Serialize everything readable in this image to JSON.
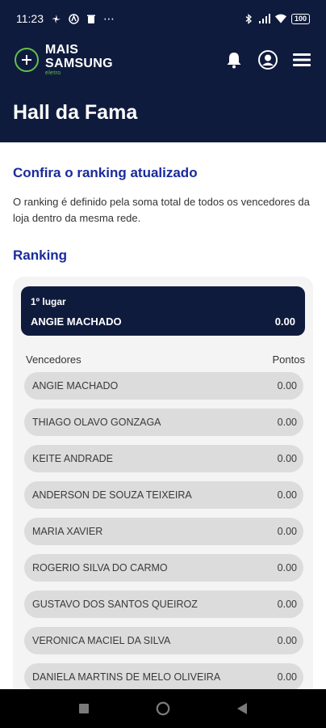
{
  "status": {
    "time": "11:23",
    "battery": "100"
  },
  "app": {
    "brand_line1": "MAIS",
    "brand_line2": "SAMSUNG",
    "brand_sub": "eletro"
  },
  "page": {
    "title": "Hall da Fama"
  },
  "intro": {
    "subtitle": "Confira o ranking atualizado",
    "description": "O ranking é definido pela soma total de todos os vencedores da loja dentro da mesma rede."
  },
  "ranking": {
    "title": "Ranking",
    "first": {
      "place_label": "1º lugar",
      "name": "ANGIE MACHADO",
      "points": "0.00"
    },
    "col_sellers": "Vencedores",
    "col_points": "Pontos",
    "rows": [
      {
        "name": "ANGIE MACHADO",
        "points": "0.00"
      },
      {
        "name": "THIAGO OLAVO GONZAGA",
        "points": "0.00"
      },
      {
        "name": "KEITE ANDRADE",
        "points": "0.00"
      },
      {
        "name": "ANDERSON DE SOUZA TEIXEIRA",
        "points": "0.00"
      },
      {
        "name": "MARIA XAVIER",
        "points": "0.00"
      },
      {
        "name": "ROGERIO SILVA DO CARMO",
        "points": "0.00"
      },
      {
        "name": "GUSTAVO DOS SANTOS QUEIROZ",
        "points": "0.00"
      },
      {
        "name": "VERONICA MACIEL DA SILVA",
        "points": "0.00"
      },
      {
        "name": "DANIELA MARTINS DE MELO OLIVEIRA",
        "points": "0.00"
      }
    ]
  },
  "colors": {
    "navy": "#0f1b3d",
    "accent_blue": "#1a2a9c",
    "brand_green": "#63c04a"
  },
  "icons": [
    "bell-icon",
    "profile-icon",
    "menu-icon",
    "recents-icon",
    "home-icon",
    "back-icon"
  ]
}
